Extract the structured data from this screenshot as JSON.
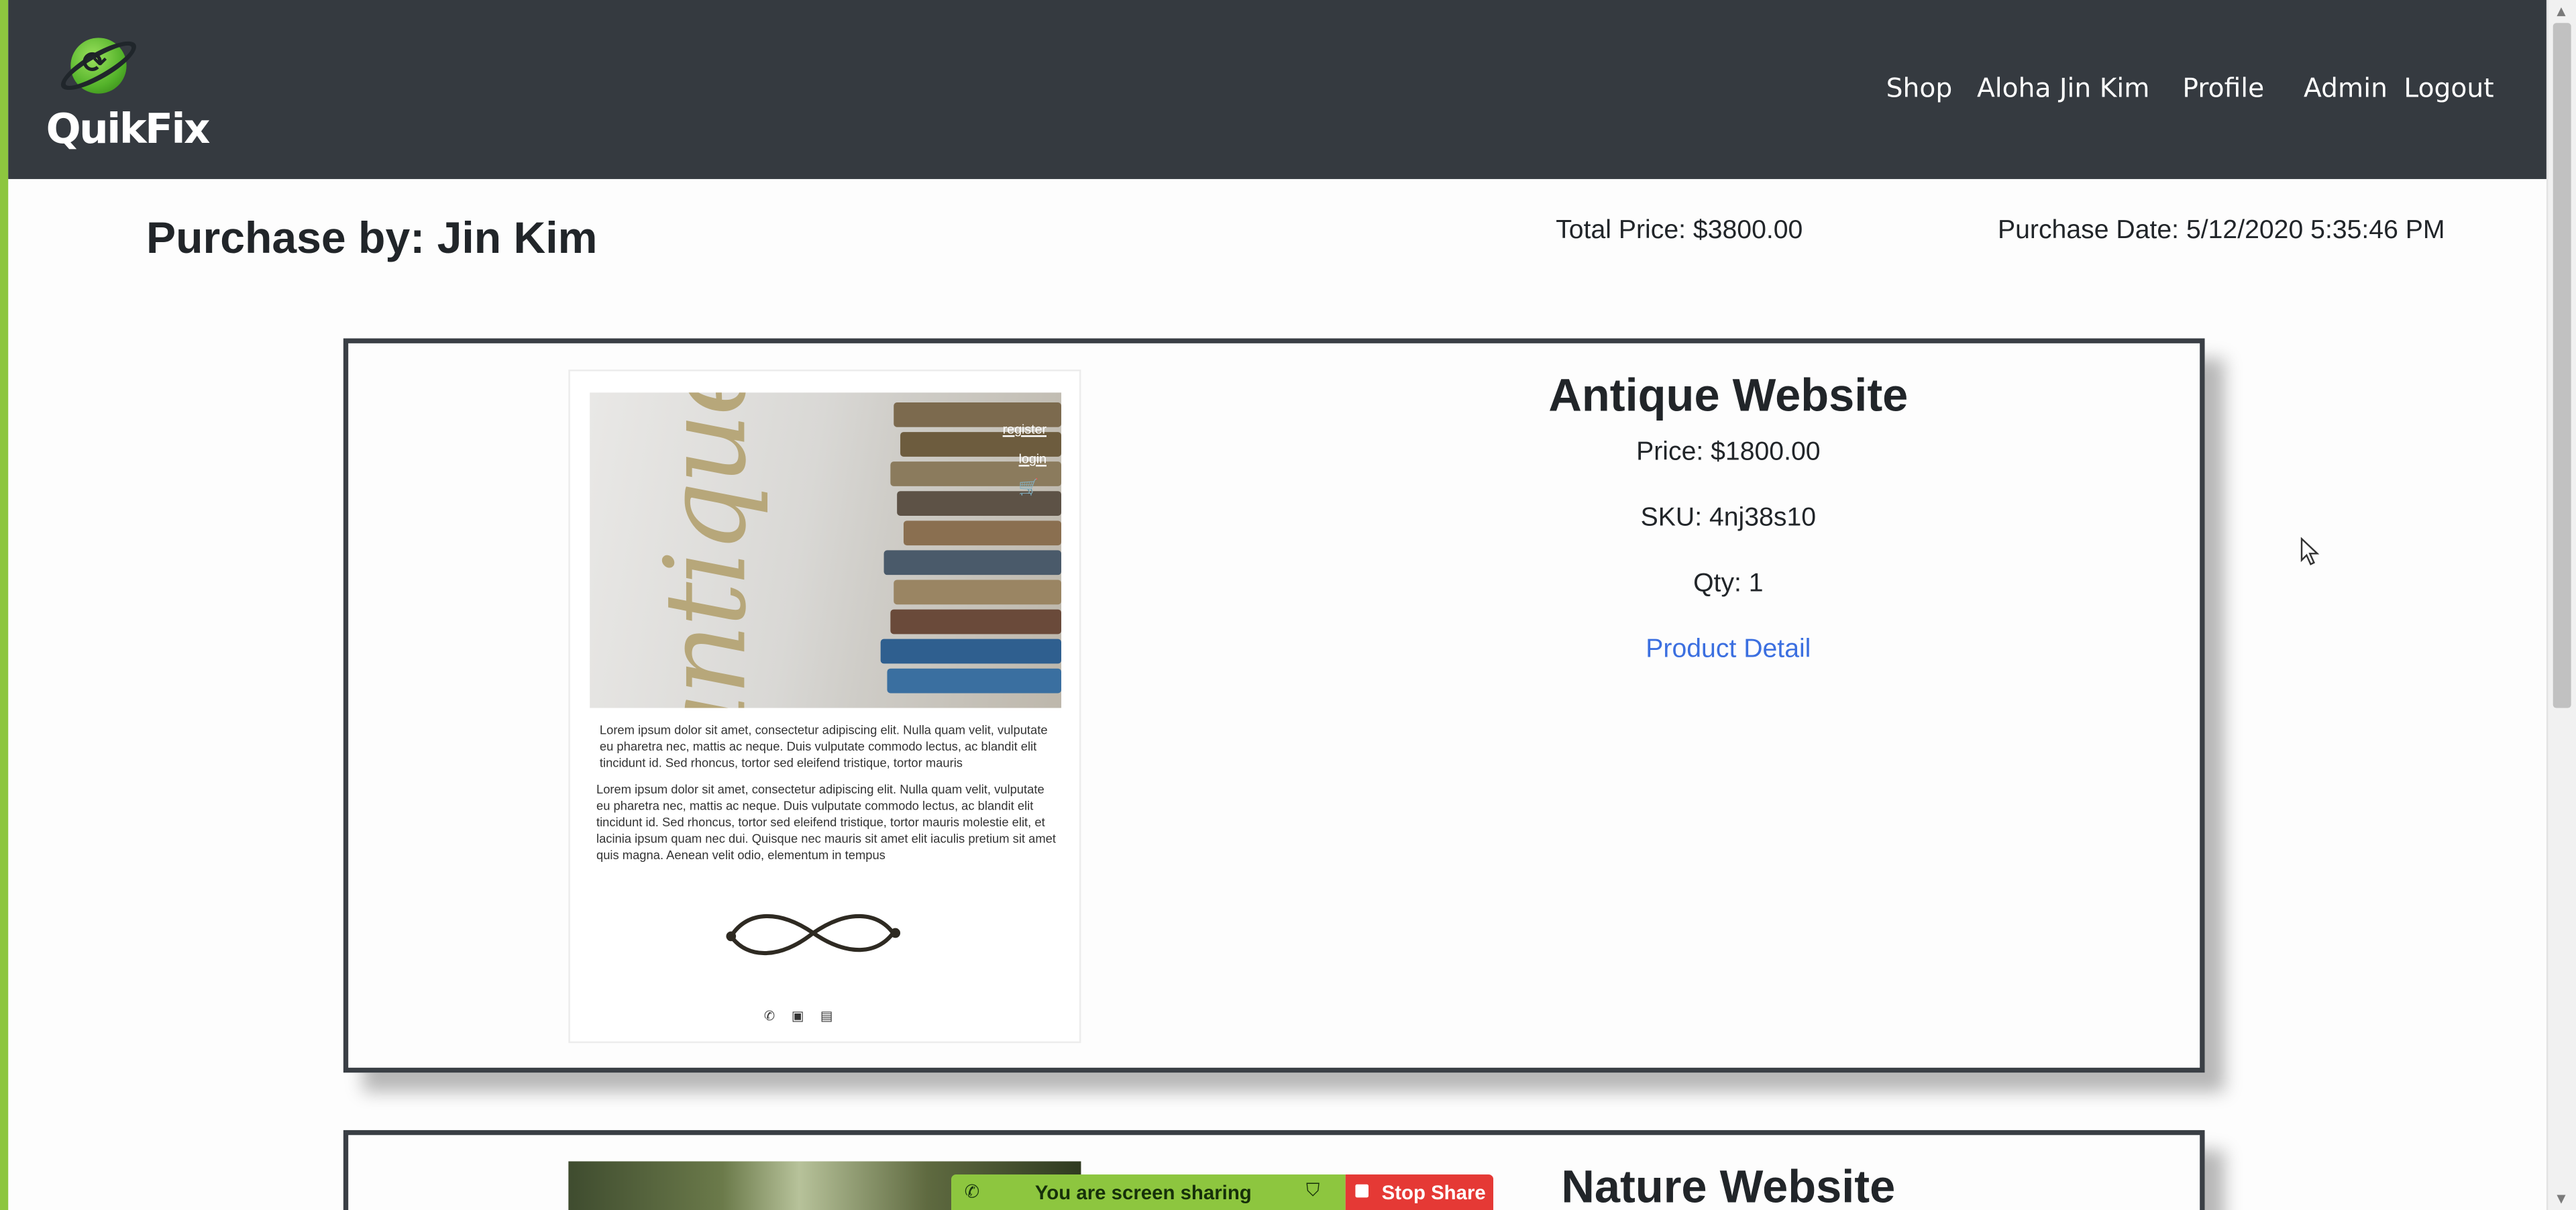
{
  "app": {
    "brand": "QuikFix"
  },
  "nav": {
    "items": [
      {
        "label": "Shop",
        "name": "nav-shop"
      },
      {
        "label": "Aloha Jin Kim",
        "name": "nav-user-greeting"
      },
      {
        "label": "Profile",
        "name": "nav-profile"
      },
      {
        "label": "Admin",
        "name": "nav-admin"
      },
      {
        "label": "Logout",
        "name": "nav-logout"
      }
    ]
  },
  "purchase": {
    "title": "Purchase by: Jin Kim",
    "total_price": "Total Price: $3800.00",
    "purchase_date": "Purchase Date: 5/12/2020 5:35:46 PM"
  },
  "items": [
    {
      "name": "Antique Website",
      "price": "Price: $1800.00",
      "sku": "SKU: 4nj38s10",
      "qty": "Qty: 1",
      "link": "Product Detail",
      "thumb": {
        "word": "antique",
        "register": "register",
        "login": "login",
        "para1": "Lorem ipsum dolor sit amet, consectetur adipiscing elit. Nulla quam velit, vulputate eu pharetra nec, mattis ac neque. Duis vulputate commodo lectus, ac blandit elit tincidunt id. Sed rhoncus, tortor sed eleifend tristique, tortor mauris",
        "para2": "Lorem ipsum dolor sit amet, consectetur adipiscing elit. Nulla quam velit, vulputate eu pharetra nec, mattis ac neque. Duis vulputate commodo lectus, ac blandit elit tincidunt id. Sed rhoncus, tortor sed eleifend tristique, tortor mauris molestie elit, et lacinia ipsum quam nec dui. Quisque nec mauris sit amet elit iaculis pretium sit amet quis magna. Aenean velit odio, elementum in tempus"
      }
    },
    {
      "name": "Nature Website"
    }
  ],
  "screen_share": {
    "status": "You are screen sharing",
    "stop_label": "Stop Share"
  },
  "colors": {
    "navbar": "#353a40",
    "accent_green": "#8dc63f",
    "link_blue": "#3b6fe0",
    "stop_red": "#e53935"
  }
}
